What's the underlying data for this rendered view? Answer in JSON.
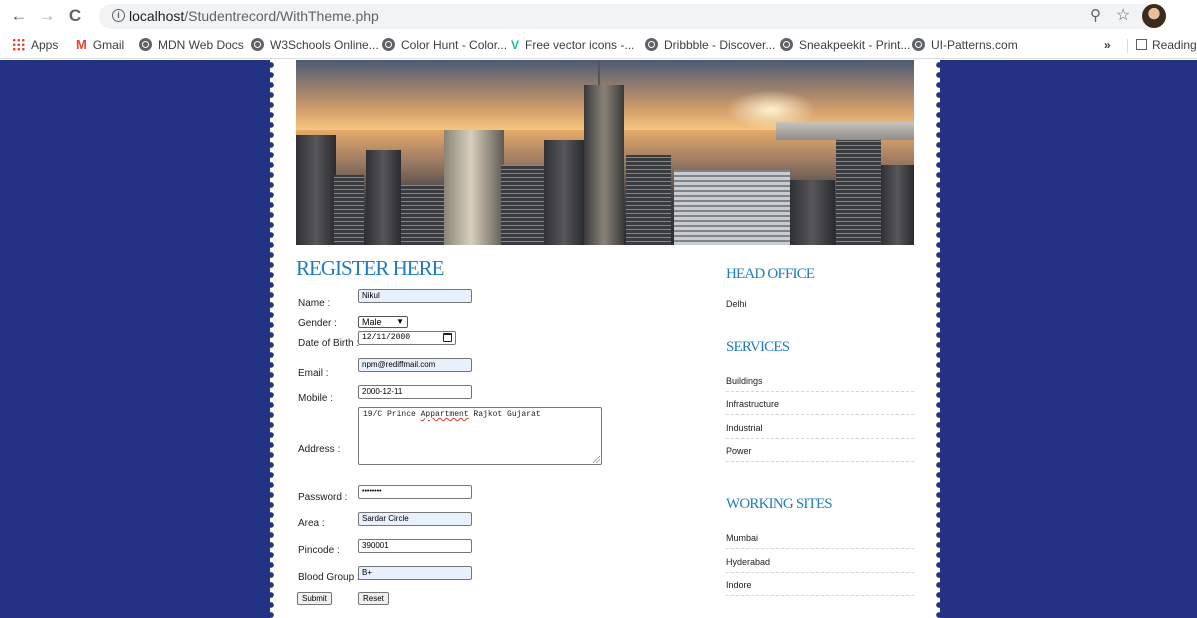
{
  "browser": {
    "url_host": "localhost",
    "url_path": "/Studentrecord/WithTheme.php",
    "nav": {
      "back": "←",
      "forward": "→",
      "reload": "C"
    },
    "bookmarks": [
      {
        "label": "Apps"
      },
      {
        "label": "Gmail"
      },
      {
        "label": "MDN Web Docs"
      },
      {
        "label": "W3Schools Online..."
      },
      {
        "label": "Color Hunt - Color..."
      },
      {
        "label": "Free vector icons -..."
      },
      {
        "label": "Dribbble - Discover..."
      },
      {
        "label": "Sneakpeekit - Print..."
      },
      {
        "label": "UI-Patterns.com"
      }
    ],
    "overflow": "»",
    "reading_list": "Reading"
  },
  "form": {
    "title": "REGISTER HERE",
    "name": {
      "label": "Name :",
      "value": "Nikul"
    },
    "gender": {
      "label": "Gender :",
      "value": "Male"
    },
    "dob": {
      "label": "Date of Birth :",
      "value": "12/11/2000"
    },
    "email": {
      "label": "Email :",
      "value": "npm@rediffmail.com"
    },
    "mobile": {
      "label": "Mobile :",
      "value": "2000-12-11"
    },
    "address": {
      "label": "Address :",
      "value_pre": "19/C Prince ",
      "value_wavy": "Appartment",
      "value_post": " Rajkot Gujarat"
    },
    "password": {
      "label": "Password :",
      "value": "••••••••"
    },
    "area": {
      "label": "Area :",
      "value": "Sardar Circle"
    },
    "pincode": {
      "label": "Pincode :",
      "value": "390001"
    },
    "blood_group": {
      "label": "Blood Group :",
      "value": "B+"
    },
    "submit_label": "Submit",
    "reset_label": "Reset"
  },
  "sidebar": {
    "head_office_title": "HEAD OFFICE",
    "head_office_city": "Delhi",
    "services_title": "SERVICES",
    "services": [
      "Buildings",
      "Infrastructure",
      "Industrial",
      "Power"
    ],
    "sites_title": "WORKING SITES",
    "sites": [
      "Mumbai",
      "Hyderabad",
      "Indore"
    ]
  },
  "colors": {
    "page_bg": "#233282",
    "accent": "#1f7cc2"
  }
}
